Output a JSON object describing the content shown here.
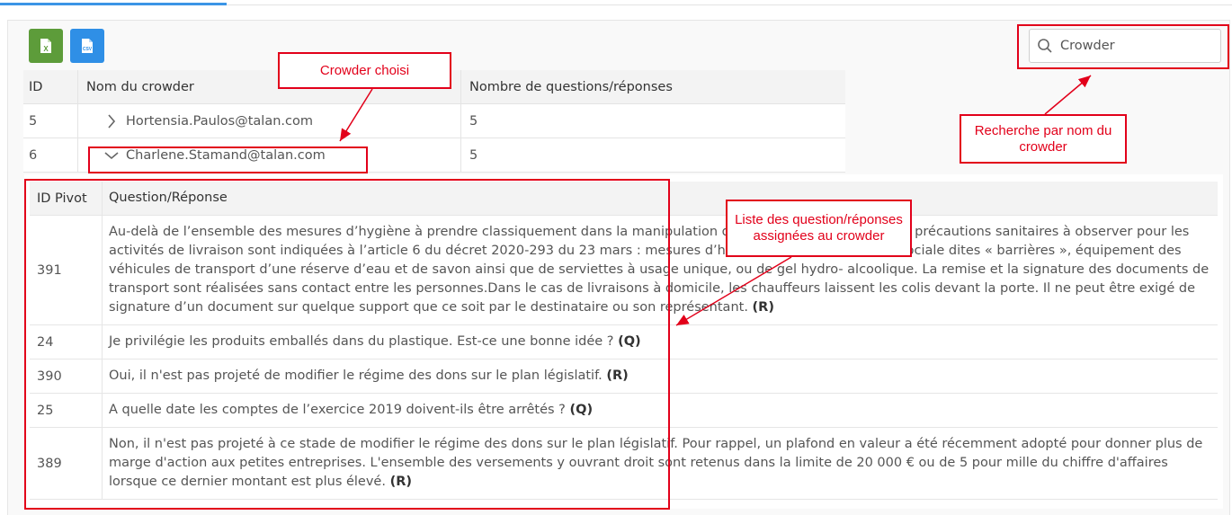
{
  "toolbar": {
    "excel_icon": "excel-file-icon",
    "csv_icon": "csv-file-icon",
    "search": {
      "value": "Crowder",
      "icon": "search-icon"
    }
  },
  "crowder_table": {
    "headers": [
      "ID",
      "Nom du crowder",
      "Nombre de questions/réponses"
    ],
    "rows": [
      {
        "id": "5",
        "name": "Hortensia.Paulos@talan.com",
        "count": "5",
        "expanded": false
      },
      {
        "id": "6",
        "name": "Charlene.Stamand@talan.com",
        "count": "5",
        "expanded": true
      }
    ]
  },
  "qa_table": {
    "headers": [
      "ID Pivot",
      "Question/Réponse"
    ],
    "rows": [
      {
        "id": "391",
        "text": "Au-delà de l’ensemble des mesures d’hygiène à prendre classiquement dans la manipulation de colis et marchandises, les précautions sanitaires à observer pour les activités de livraison sont indiquées à l’article 6 du décret 2020-293 du 23 mars : mesures d’hygiène et de distanciation sociale dites « barrières », équipement des véhicules de transport d’une réserve d’eau et de savon ainsi que de serviettes à usage unique, ou de gel hydro- alcoolique. La remise et la signature des documents de transport sont réalisées sans contact entre les personnes.Dans le cas de livraisons à domicile, les chauffeurs laissent les colis devant la porte. Il ne peut être exigé de signature d’un document sur quelque support que ce soit par le destinataire ou son représentant.",
        "tag": "(R)"
      },
      {
        "id": "24",
        "text": "Je privilégie les produits emballés dans du plastique. Est-ce une bonne idée ?",
        "tag": "(Q)"
      },
      {
        "id": "390",
        "text": "Oui, il n'est pas projeté de modifier le régime des dons sur le plan législatif.",
        "tag": "(R)"
      },
      {
        "id": "25",
        "text": "A quelle date les comptes de l’exercice 2019 doivent-ils être arrêtés ?",
        "tag": "(Q)"
      },
      {
        "id": "389",
        "text": "Non, il n'est pas projeté à ce stade de modifier le régime des dons sur le plan législatif. Pour rappel, un plafond en valeur a été récemment adopté pour donner plus de marge d'action aux petites entreprises. L'ensemble des versements y ouvrant droit sont retenus dans la limite de 20 000 € ou de 5 pour mille du chiffre d'affaires lorsque ce dernier montant est plus élevé.",
        "tag": "(R)"
      }
    ]
  },
  "annotations": {
    "crowder_choisi": "Crowder choisi",
    "recherche": "Recherche par nom du crowder",
    "liste": "Liste des question/réponses assignées au crowder",
    "color": "#e2001a"
  },
  "colors": {
    "accent": "#3b95e6",
    "excel": "#5d9c3a",
    "csv": "#2f8fe6"
  }
}
